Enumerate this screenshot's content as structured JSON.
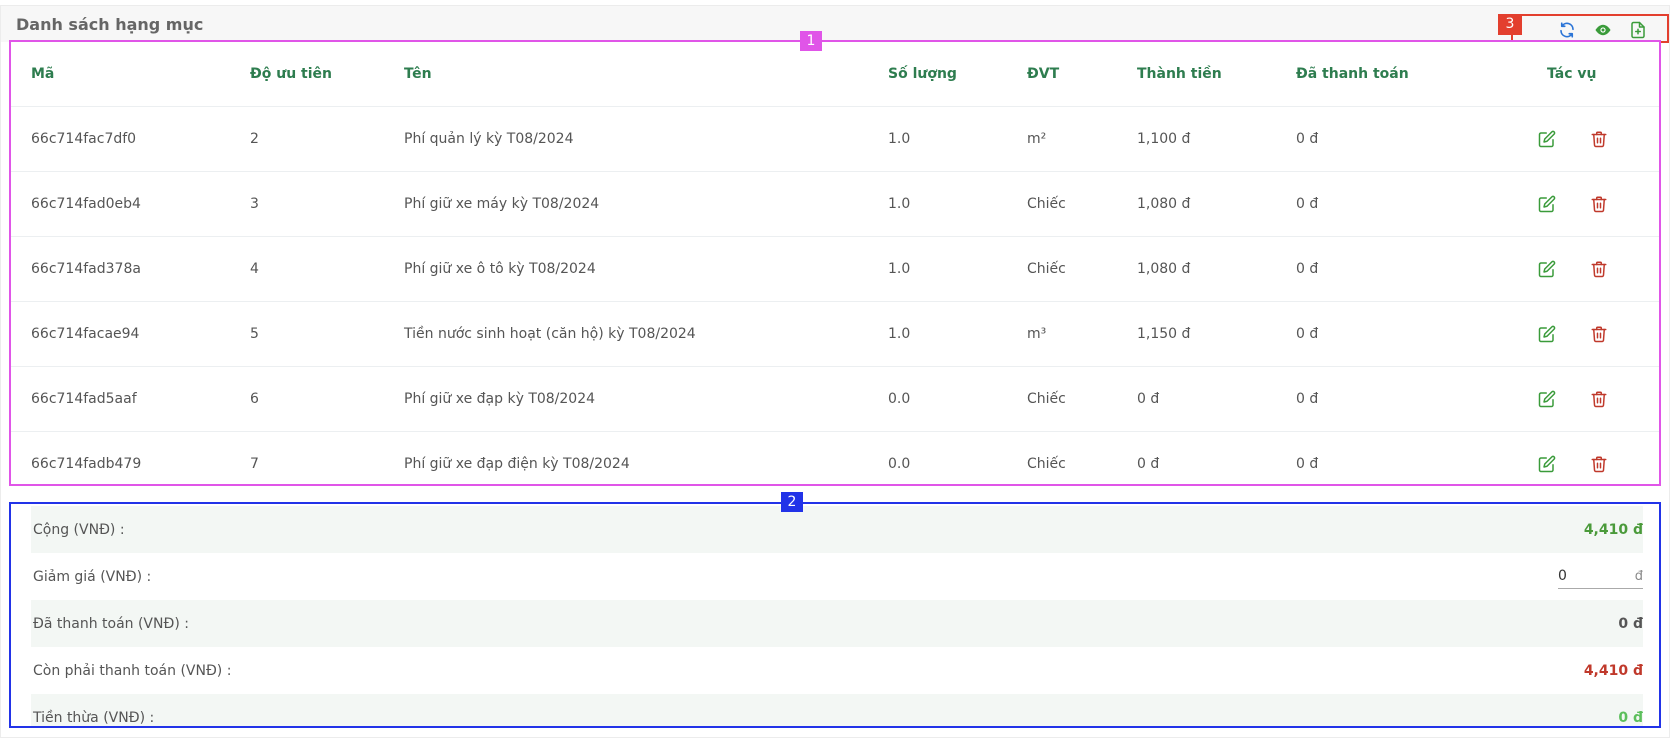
{
  "header": {
    "title": "Danh sách hạng mục"
  },
  "markers": {
    "table": "1",
    "summary": "2",
    "tools": "3"
  },
  "toolbar": {
    "icons": [
      "refresh-icon",
      "eye-icon",
      "file-add-icon"
    ],
    "colors": {
      "refresh": "#2b74d6",
      "view": "#3a9b3a",
      "add": "#3a9b3a"
    }
  },
  "table": {
    "columns": {
      "code": "Mã",
      "priority": "Độ ưu tiên",
      "name": "Tên",
      "quantity": "Số lượng",
      "unit": "ĐVT",
      "amount": "Thành tiền",
      "paid": "Đã thanh toán",
      "actions": "Tác vụ"
    },
    "rows": [
      {
        "code": "66c714fac7df0",
        "priority": "2",
        "name": "Phí quản lý kỳ T08/2024",
        "quantity": "1.0",
        "unit": "m²",
        "amount": "1,100 đ",
        "paid": "0 đ"
      },
      {
        "code": "66c714fad0eb4",
        "priority": "3",
        "name": "Phí giữ xe máy kỳ T08/2024",
        "quantity": "1.0",
        "unit": "Chiếc",
        "amount": "1,080 đ",
        "paid": "0 đ"
      },
      {
        "code": "66c714fad378a",
        "priority": "4",
        "name": "Phí giữ xe ô tô kỳ T08/2024",
        "quantity": "1.0",
        "unit": "Chiếc",
        "amount": "1,080 đ",
        "paid": "0 đ"
      },
      {
        "code": "66c714facae94",
        "priority": "5",
        "name": "Tiền nước sinh hoạt (căn hộ) kỳ T08/2024",
        "quantity": "1.0",
        "unit": "m³",
        "amount": "1,150 đ",
        "paid": "0 đ"
      },
      {
        "code": "66c714fad5aaf",
        "priority": "6",
        "name": "Phí giữ xe đạp kỳ T08/2024",
        "quantity": "0.0",
        "unit": "Chiếc",
        "amount": "0 đ",
        "paid": "0 đ"
      },
      {
        "code": "66c714fadb479",
        "priority": "7",
        "name": "Phí giữ xe đạp điện kỳ T08/2024",
        "quantity": "0.0",
        "unit": "Chiếc",
        "amount": "0 đ",
        "paid": "0 đ"
      }
    ],
    "row_icons": [
      "edit-icon",
      "delete-icon"
    ],
    "colors": {
      "header": "#2e7d4f",
      "edit": "#3a9b3a",
      "delete": "#c0392b"
    }
  },
  "summary": {
    "total_label": "Cộng (VNĐ) :",
    "total_value": "4,410 đ",
    "discount_label": "Giảm giá (VNĐ) :",
    "discount_value": "0",
    "discount_unit": "đ",
    "paid_label": "Đã thanh toán (VNĐ) :",
    "paid_value": "0 đ",
    "remaining_label": "Còn phải thanh toán (VNĐ) :",
    "remaining_value": "4,410 đ",
    "change_label": "Tiền thừa (VNĐ) :",
    "change_value": "0 đ",
    "colors": {
      "total": "#4a9a3a",
      "paid": "#555555",
      "remaining": "#c0392b",
      "change": "#5cbf5c"
    }
  }
}
